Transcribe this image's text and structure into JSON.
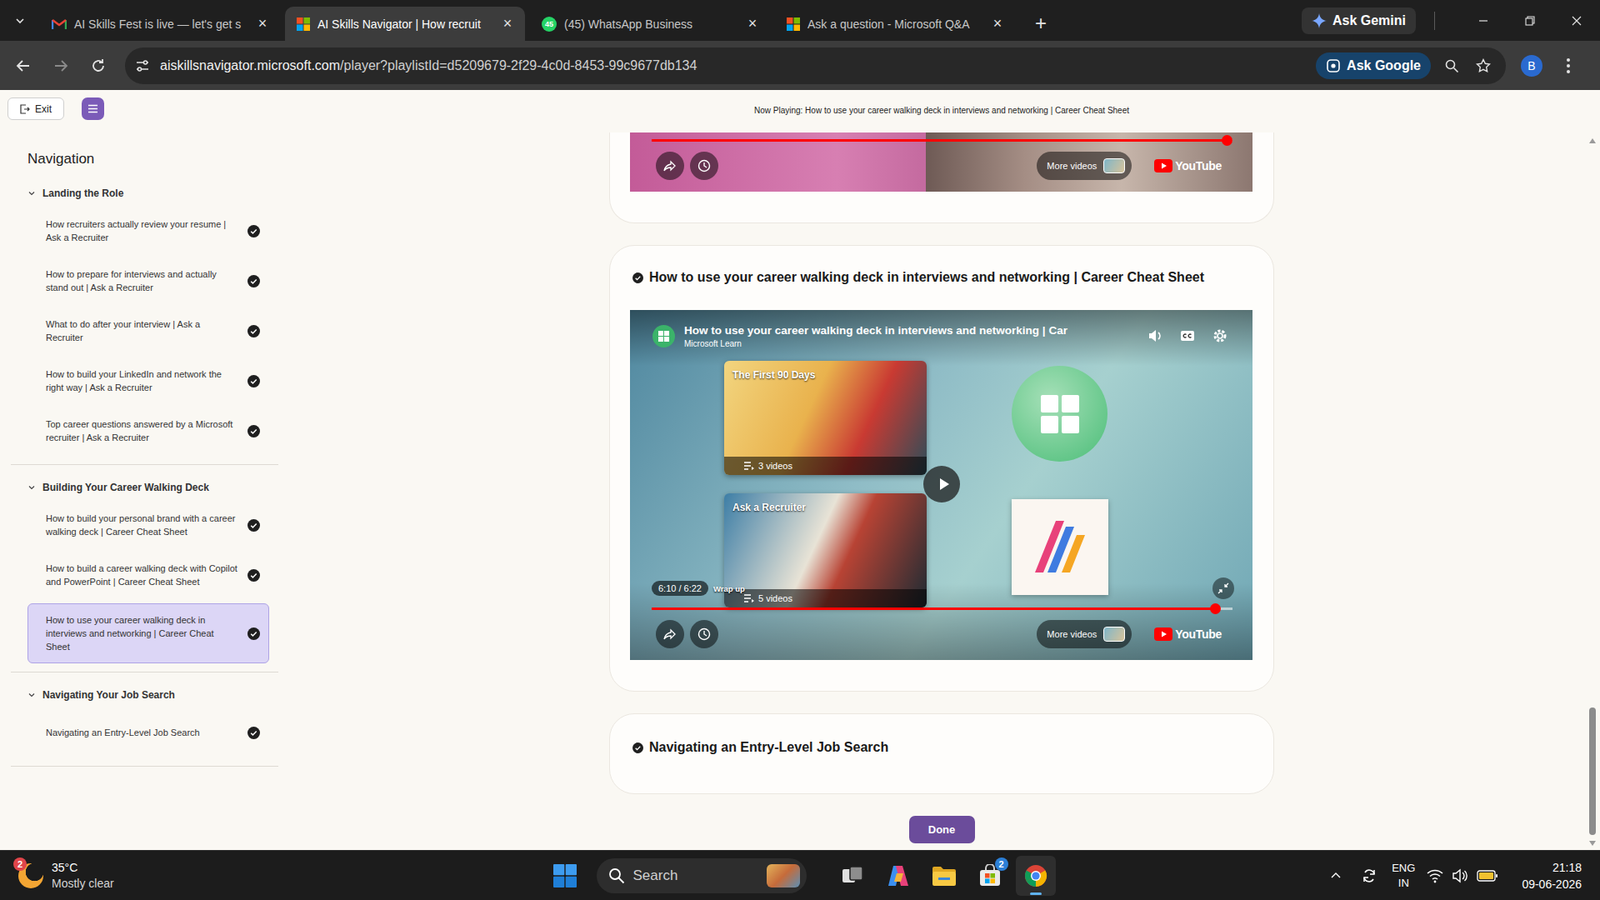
{
  "browser": {
    "tabs": [
      {
        "label": "AI Skills Fest is live — let's get s",
        "kind": "gmail",
        "badge": "",
        "selected": false
      },
      {
        "label": "AI Skills Navigator | How recruit",
        "kind": "microsoft",
        "badge": "",
        "selected": true
      },
      {
        "label": "(45) WhatsApp Business",
        "kind": "whatsapp",
        "badge": "45",
        "selected": false
      },
      {
        "label": "Ask a question - Microsoft Q&A",
        "kind": "microsoft",
        "badge": "",
        "selected": false
      }
    ],
    "tab_close": "×",
    "new_tab": "+",
    "gemini": "Ask Gemini",
    "url_host": "aiskillsnavigator.microsoft.com",
    "url_path": "/player?playlistId=d5209679-2f29-4c0d-8453-99c9677db134",
    "ask_google": "Ask Google",
    "profile": "B"
  },
  "page": {
    "exit": "Exit",
    "now_playing": "Now Playing: How to use your career walking deck in interviews and networking | Career Cheat Sheet",
    "nav_title": "Navigation",
    "sections": [
      {
        "title": "Landing the Role",
        "expanded": true,
        "items": [
          {
            "label": "How recruiters actually review your resume | Ask a Recruiter",
            "done": true,
            "selected": false
          },
          {
            "label": "How to prepare for interviews and actually stand out | Ask a Recruiter",
            "done": true,
            "selected": false
          },
          {
            "label": "What to do after your interview | Ask a Recruiter",
            "done": true,
            "selected": false
          },
          {
            "label": "How to build your LinkedIn and network the right way | Ask a Recruiter",
            "done": true,
            "selected": false
          },
          {
            "label": "Top career questions answered by a Microsoft recruiter | Ask a Recruiter",
            "done": true,
            "selected": false
          }
        ]
      },
      {
        "title": "Building Your Career Walking Deck",
        "expanded": true,
        "items": [
          {
            "label": "How to build your personal brand with a career walking deck | Career Cheat Sheet",
            "done": true,
            "selected": false
          },
          {
            "label": "How to build a career walking deck with Copilot and PowerPoint | Career Cheat Sheet",
            "done": true,
            "selected": false
          },
          {
            "label": "How to use your career walking deck in interviews and networking | Career Cheat Sheet",
            "done": true,
            "selected": true
          }
        ]
      },
      {
        "title": "Navigating Your Job Search",
        "expanded": true,
        "items": [
          {
            "label": "Navigating an Entry-Level Job Search",
            "done": true,
            "selected": false
          }
        ]
      }
    ],
    "cards": [
      {
        "kind": "tail",
        "video": {
          "progress": 0.99,
          "more_videos": "More videos",
          "brand": "YouTube"
        }
      },
      {
        "kind": "video",
        "title": "How to use your career walking deck in interviews and networking | Career Cheat Sheet",
        "done": true,
        "video": {
          "title": "How to use your career walking deck in interviews and networking | Car",
          "channel": "Microsoft Learn",
          "time": "6:10 / 6:22",
          "chapter": "Wrap up",
          "progress": 0.97,
          "more_videos": "More videos",
          "brand": "YouTube",
          "endscreen": [
            {
              "title": "The First 90 Days",
              "count": "3 videos"
            },
            {
              "title": "Ask a Recruiter",
              "count": "5 videos"
            }
          ]
        }
      },
      {
        "kind": "title",
        "title": "Navigating an Entry-Level Job Search",
        "done": true
      }
    ],
    "done": "Done"
  },
  "taskbar": {
    "temperature": "35°C",
    "weather": "Mostly clear",
    "weather_badge": "2",
    "search": "Search",
    "apps": [
      {
        "kind": "task-view",
        "badge": "",
        "active": false
      },
      {
        "kind": "copilot",
        "badge": "",
        "active": false
      },
      {
        "kind": "explorer",
        "badge": "",
        "active": false
      },
      {
        "kind": "store",
        "badge": "2",
        "active": false
      },
      {
        "kind": "chrome",
        "badge": "",
        "active": true
      }
    ],
    "language": "ENG",
    "region": "IN",
    "time": "21:18",
    "date": "09-06-2026"
  }
}
